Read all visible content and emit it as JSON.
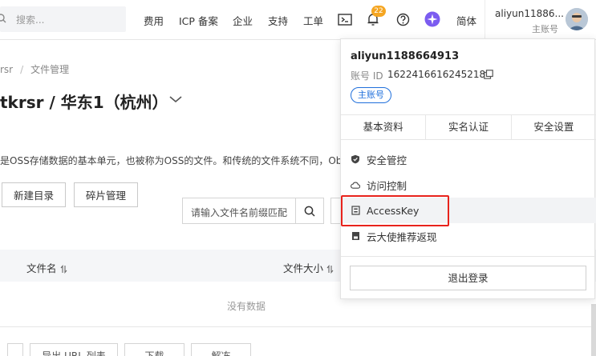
{
  "header": {
    "search_placeholder": "搜索...",
    "nav": [
      "费用",
      "ICP 备案",
      "企业",
      "支持",
      "工单"
    ],
    "notification_count": "22",
    "language": "简体",
    "user_name": "aliyun11886...",
    "user_role": "主账号"
  },
  "breadcrumb": [
    "rsr",
    "文件管理"
  ],
  "page_title": "tkrsr / 华东1（杭州）",
  "description": "是OSS存储数据的基本单元，也被称为OSS的文件。和传统的文件系统不同，Objec",
  "toolbar": {
    "new_dir": "新建目录",
    "fragments": "碎片管理",
    "filter_placeholder": "请输入文件名前缀匹配"
  },
  "table": {
    "columns": [
      "文件名",
      "文件大小"
    ],
    "empty_text": "没有数据"
  },
  "bottom_buttons": [
    "",
    "导出 URL 列表",
    "下载",
    "解冻"
  ],
  "dropdown": {
    "account_name": "aliyun1188664913",
    "account_id_label": "账号 ID",
    "account_id": "1622416616245218",
    "account_tag": "主账号",
    "tabs": [
      "基本资料",
      "实名认证",
      "安全设置"
    ],
    "items": [
      "安全管控",
      "访问控制",
      "AccessKey",
      "云大使推荐返现"
    ],
    "logout": "退出登录"
  },
  "colors": {
    "accent": "#1f6fdb",
    "highlight": "#e8231c",
    "badge": "#f5a623"
  }
}
